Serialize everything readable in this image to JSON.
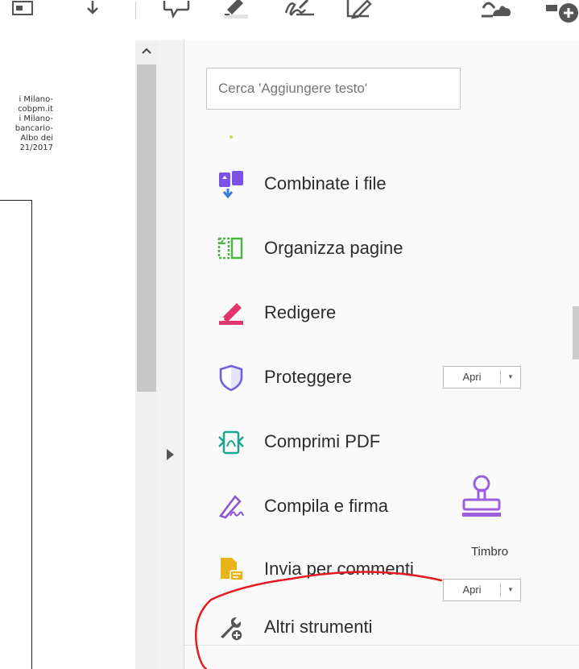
{
  "toolbar": {
    "icons": [
      "sidebar-toggle-icon",
      "download-icon",
      "comment-icon",
      "highlight-icon",
      "sign-icon",
      "edit-pen-icon",
      "cloud-share-icon",
      "more-tools-icon"
    ]
  },
  "document": {
    "lines": [
      "i Milano-",
      "cobpm.it",
      "i Milano-",
      "bancario-",
      "Albo dei",
      "21/2017"
    ]
  },
  "search": {
    "placeholder": "Cerca 'Aggiungere testo'"
  },
  "tools": [
    {
      "label": "Combinate i file",
      "icon": "combine-files-icon",
      "color": "#7b52e3"
    },
    {
      "label": "Organizza pagine",
      "icon": "organize-pages-icon",
      "color": "#4bb545"
    },
    {
      "label": "Redigere",
      "icon": "redact-icon",
      "color": "#e0376d"
    },
    {
      "label": "Proteggere",
      "icon": "protect-shield-icon",
      "color": "#6b60e0"
    },
    {
      "label": "Comprimi PDF",
      "icon": "compress-pdf-icon",
      "color": "#1fa58f"
    },
    {
      "label": "Compila e firma",
      "icon": "fill-sign-icon",
      "color": "#8b55d8"
    },
    {
      "label": "Invia per commenti",
      "icon": "send-comments-icon",
      "color": "#e7b51a"
    },
    {
      "label": "Altri strumenti",
      "icon": "more-tools-wrench-icon",
      "color": "#555555"
    }
  ],
  "open_buttons": {
    "protect": {
      "label": "Apri"
    },
    "stamp": {
      "label": "Apri"
    }
  },
  "stamp_tool": {
    "label": "Timbro",
    "icon": "stamp-icon",
    "color": "#9b5fe0"
  },
  "colors": {
    "annotation_red": "#e31b23",
    "pane_background": "#fafafa"
  }
}
